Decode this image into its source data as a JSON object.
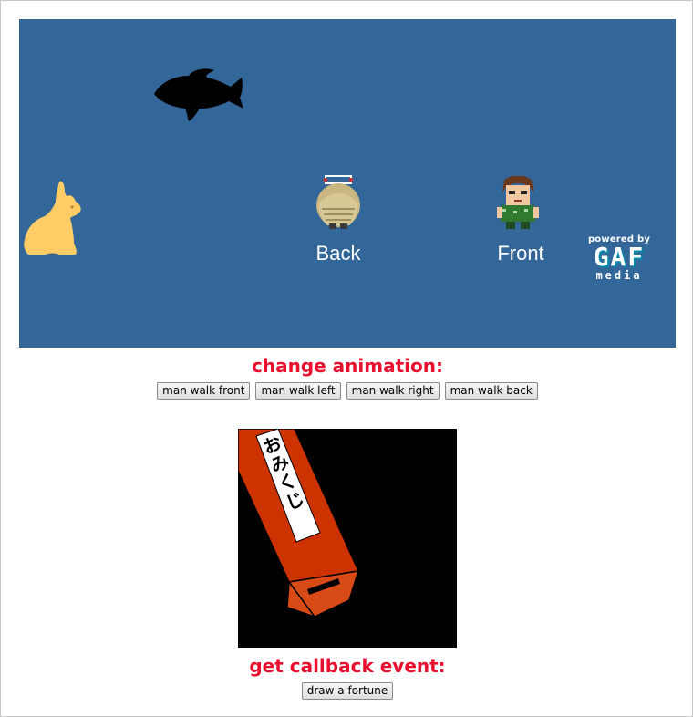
{
  "stage": {
    "background_color": "#336699",
    "labels": {
      "back": "Back",
      "front": "Front"
    },
    "sprites": [
      "fish-icon",
      "rabbit-icon",
      "man-back-icon",
      "man-front-icon"
    ],
    "badge": {
      "top": "powered by",
      "main": "GAF",
      "sub": "media"
    }
  },
  "animation_section": {
    "title": "change animation:",
    "buttons": [
      "man walk front",
      "man walk left",
      "man walk right",
      "man walk back"
    ]
  },
  "fortune": {
    "box_text": "おみくじ",
    "background_color": "#000000",
    "stick_color": "#cc3300"
  },
  "callback_section": {
    "title": "get callback event:",
    "button": "draw a fortune"
  },
  "colors": {
    "title": "#e8102e",
    "rabbit": "#ffcc66"
  }
}
